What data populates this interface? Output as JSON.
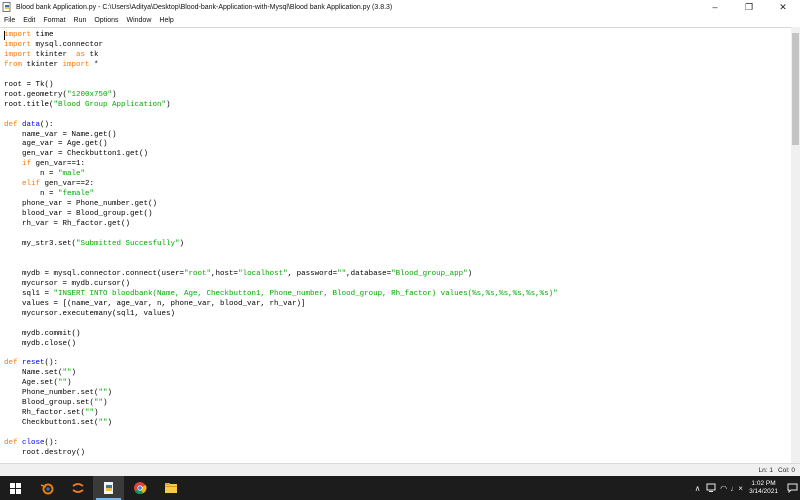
{
  "window": {
    "title": "Blood bank Application.py - C:\\Users\\Aditya\\Desktop\\Blood-bank-Application-with-Mysql\\Blood bank Application.py (3.8.3)",
    "minimize": "–",
    "maximize": "❐",
    "close": "✕"
  },
  "menu": [
    "File",
    "Edit",
    "Format",
    "Run",
    "Options",
    "Window",
    "Help"
  ],
  "status": {
    "line": "Ln: 1",
    "col": "Col: 0"
  },
  "taskbar": {
    "time": "1:02 PM",
    "date": "3/14/2021",
    "chevron": "∧",
    "wifi": "◠",
    "volume": "♩×"
  },
  "colors": {
    "keyword": "#ff7700",
    "string": "#00aa00",
    "function": "#0000ff",
    "accent": "#76b9ed"
  },
  "code_lines": [
    [
      [
        "kw",
        "import"
      ],
      [
        "",
        " time"
      ]
    ],
    [
      [
        "kw",
        "import"
      ],
      [
        "",
        " mysql.connector"
      ]
    ],
    [
      [
        "kw",
        "import"
      ],
      [
        "",
        " tkinter  "
      ],
      [
        "kw",
        "as"
      ],
      [
        "",
        " tk"
      ]
    ],
    [
      [
        "kw",
        "from"
      ],
      [
        "",
        " tkinter "
      ],
      [
        "kw",
        "import"
      ],
      [
        "",
        " *"
      ]
    ],
    [],
    [
      [
        "",
        "root = Tk()"
      ]
    ],
    [
      [
        "",
        "root.geometry("
      ],
      [
        "st",
        "\"1200x750\""
      ],
      [
        "",
        ")"
      ]
    ],
    [
      [
        "",
        "root.title("
      ],
      [
        "st",
        "\"Blood Group Application\""
      ],
      [
        "",
        ")"
      ]
    ],
    [],
    [
      [
        "kw",
        "def"
      ],
      [
        "",
        " "
      ],
      [
        "fn",
        "data"
      ],
      [
        "",
        "():"
      ]
    ],
    [
      [
        "",
        "    name_var = Name.get()"
      ]
    ],
    [
      [
        "",
        "    age_var = Age.get()"
      ]
    ],
    [
      [
        "",
        "    gen_var = Checkbutton1.get()"
      ]
    ],
    [
      [
        "",
        "    "
      ],
      [
        "kw",
        "if"
      ],
      [
        "",
        " gen_var==1:"
      ]
    ],
    [
      [
        "",
        "        n = "
      ],
      [
        "st",
        "\"male\""
      ]
    ],
    [
      [
        "",
        "    "
      ],
      [
        "kw",
        "elif"
      ],
      [
        "",
        " gen_var==2:"
      ]
    ],
    [
      [
        "",
        "        n = "
      ],
      [
        "st",
        "\"female\""
      ]
    ],
    [
      [
        "",
        "    phone_var = Phone_number.get()"
      ]
    ],
    [
      [
        "",
        "    blood_var = Blood_group.get()"
      ]
    ],
    [
      [
        "",
        "    rh_var = Rh_factor.get()"
      ]
    ],
    [],
    [
      [
        "",
        "    my_str3.set("
      ],
      [
        "st",
        "\"Submitted Succesfully\""
      ],
      [
        "",
        ")"
      ]
    ],
    [],
    [],
    [
      [
        "",
        "    mydb = mysql.connector.connect(user="
      ],
      [
        "st",
        "\"root\""
      ],
      [
        "",
        ",host="
      ],
      [
        "st",
        "\"localhost\""
      ],
      [
        "",
        ", password="
      ],
      [
        "st",
        "\"\""
      ],
      [
        "",
        ",database="
      ],
      [
        "st",
        "\"Blood_group_app\""
      ],
      [
        "",
        ")"
      ]
    ],
    [
      [
        "",
        "    mycursor = mydb.cursor()"
      ]
    ],
    [
      [
        "",
        "    sql1 = "
      ],
      [
        "st",
        "\"INSERT INTO bloodbank(Name, Age, Checkbutton1, Phone_number, Blood_group, Rh_factor) values(%s,%s,%s,%s,%s,%s)\""
      ]
    ],
    [
      [
        "",
        "    values = [(name_var, age_var, n, phone_var, blood_var, rh_var)]"
      ]
    ],
    [
      [
        "",
        "    mycursor.executemany(sql1, values)"
      ]
    ],
    [],
    [
      [
        "",
        "    mydb.commit()"
      ]
    ],
    [
      [
        "",
        "    mydb.close()"
      ]
    ],
    [],
    [
      [
        "kw",
        "def"
      ],
      [
        "",
        " "
      ],
      [
        "fn",
        "reset"
      ],
      [
        "",
        "():"
      ]
    ],
    [
      [
        "",
        "    Name.set("
      ],
      [
        "st",
        "\"\""
      ],
      [
        "",
        ")"
      ]
    ],
    [
      [
        "",
        "    Age.set("
      ],
      [
        "st",
        "\"\""
      ],
      [
        "",
        ")"
      ]
    ],
    [
      [
        "",
        "    Phone_number.set("
      ],
      [
        "st",
        "\"\""
      ],
      [
        "",
        ")"
      ]
    ],
    [
      [
        "",
        "    Blood_group.set("
      ],
      [
        "st",
        "\"\""
      ],
      [
        "",
        ")"
      ]
    ],
    [
      [
        "",
        "    Rh_factor.set("
      ],
      [
        "st",
        "\"\""
      ],
      [
        "",
        ")"
      ]
    ],
    [
      [
        "",
        "    Checkbutton1.set("
      ],
      [
        "st",
        "\"\""
      ],
      [
        "",
        ")"
      ]
    ],
    [],
    [
      [
        "kw",
        "def"
      ],
      [
        "",
        " "
      ],
      [
        "fn",
        "close"
      ],
      [
        "",
        "():"
      ]
    ],
    [
      [
        "",
        "    root.destroy()"
      ]
    ]
  ]
}
